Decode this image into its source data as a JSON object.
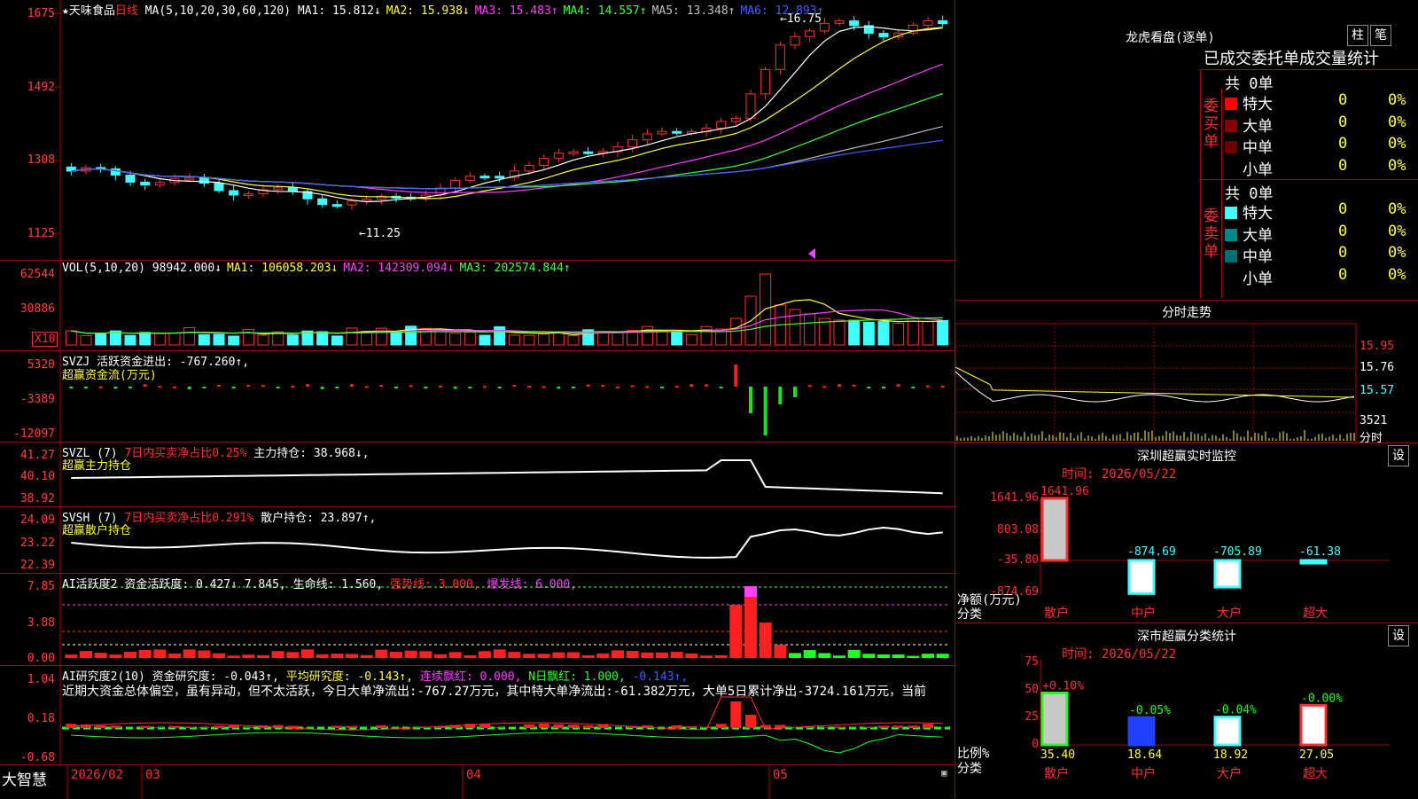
{
  "main": {
    "stock_name": "★天味食品",
    "period": "日线",
    "ma_params": "MA(5,10,20,30,60,120)",
    "ma_values": [
      {
        "label": "MA1: 15.812↓",
        "color": "#ffffff"
      },
      {
        "label": "MA2: 15.938↓",
        "color": "#ffff40"
      },
      {
        "label": "MA3: 15.483↑",
        "color": "#ff40ff"
      },
      {
        "label": "MA4: 14.557↑",
        "color": "#40ff40"
      },
      {
        "label": "MA5: 13.348↑",
        "color": "#c0c0c0"
      },
      {
        "label": "MA6: 12.893↑",
        "color": "#4060ff"
      }
    ],
    "y_ticks": [
      "1675",
      "1492",
      "1308",
      "1125"
    ],
    "high_label": "16.75",
    "low_label": "11.25"
  },
  "vol": {
    "title": "VOL(5,10,20)",
    "vals": [
      {
        "label": "98942.000↓",
        "color": "#ffffff"
      },
      {
        "label": "MA1: 106058.203↓",
        "color": "#ffff40"
      },
      {
        "label": "MA2: 142309.094↓",
        "color": "#ff40ff"
      },
      {
        "label": "MA3: 202574.844↑",
        "color": "#40ff40"
      }
    ],
    "y_ticks": [
      "62544",
      "30886"
    ],
    "unit": "X10"
  },
  "svzj": {
    "title": "SVZJ",
    "line1": "活跃资金进出: -767.260↑,",
    "line2": "超赢资金流(万元)",
    "y_ticks": [
      "5320",
      "-3389",
      "-12097"
    ]
  },
  "svzl": {
    "title": "SVZL (7)",
    "t1": "7日内买卖净占比0.25%",
    "t2": "主力持仓: 38.968↓,",
    "line2": "超赢主力持仓",
    "y_ticks": [
      "41.27",
      "40.10",
      "38.92"
    ]
  },
  "svsh": {
    "title": "SVSH (7)",
    "t1": "7日内买卖净占比0.291%",
    "t2": "散户持仓: 23.897↑,",
    "line2": "超赢散户持仓",
    "y_ticks": [
      "24.09",
      "23.22",
      "22.39"
    ]
  },
  "ai1": {
    "title": "AI活跃度2",
    "t1": "资金活跃度: 0.427↓",
    "t2": "7.845,",
    "t3": "生命线: 1.560,",
    "t4": "强势线: 3.000,",
    "t5": "爆发线: 6.000,",
    "y_ticks": [
      "7.85",
      "3.88",
      "0.00"
    ]
  },
  "ai2": {
    "title": "AI研究度2(10)",
    "t1": "资金研究度: -0.043↑,",
    "t2": "平均研究度: -0.143↑,",
    "t3": "连续飘红: 0.000,",
    "t4": "N日飘红: 1.000,",
    "t5": "-0.143↑,",
    "comment": "近期大资金总体偏空，虽有异动，但不太活跃，今日大单净流出:-767.27万元，其中特大单净流出:-61.382万元，大单5日累计净出-3724.161万元，当前",
    "y_ticks": [
      "1.04",
      "0.18",
      "-0.68"
    ]
  },
  "footer": {
    "brand": "大智慧",
    "dates": [
      "2026/02",
      "03",
      "04",
      "05"
    ]
  },
  "longhu": {
    "title": "龙虎看盘(逐单)",
    "btn_bar": "柱",
    "btn_pen": "笔",
    "tabs": "已成交委托单成交量统计",
    "buy_total": "共 0单",
    "buy_label": "委买单",
    "sell_total": "共 0单",
    "sell_label": "委卖单",
    "buy_rows": [
      {
        "name": "特大",
        "val": "0",
        "pct": "0%",
        "color": "#ff0000"
      },
      {
        "name": "大单",
        "val": "0",
        "pct": "0%",
        "color": "#8a0000"
      },
      {
        "name": "中单",
        "val": "0",
        "pct": "0%",
        "color": "#6a0000"
      },
      {
        "name": "小单",
        "val": "0",
        "pct": "0%",
        "color": "#000000"
      }
    ],
    "sell_rows": [
      {
        "name": "特大",
        "val": "0",
        "pct": "0%",
        "color": "#40ffff"
      },
      {
        "name": "大单",
        "val": "0",
        "pct": "0%",
        "color": "#008888"
      },
      {
        "name": "中单",
        "val": "0",
        "pct": "0%",
        "color": "#007070"
      },
      {
        "name": "小单",
        "val": "0",
        "pct": "0%",
        "color": "#000000"
      }
    ]
  },
  "intraday": {
    "title": "分时走势",
    "y_ticks": [
      "15.95",
      "15.76",
      "15.57"
    ],
    "vol_label": "3521",
    "unit": "分时"
  },
  "sz_monitor": {
    "title": "深圳超赢实时监控",
    "btn": "设",
    "time": "时间: 2026/05/22",
    "y_ticks": [
      "1641.96",
      "803.08",
      "-35.80",
      "-874.69"
    ],
    "bars": [
      {
        "cat": "散户",
        "value": 1641.96,
        "label": "1641.96"
      },
      {
        "cat": "中户",
        "value": -874.69,
        "label": "-874.69"
      },
      {
        "cat": "大户",
        "value": -705.89,
        "label": "-705.89"
      },
      {
        "cat": "超大",
        "value": -61.38,
        "label": "-61.38"
      }
    ],
    "ylabel": "净额(万元)",
    "xlabel": "分类"
  },
  "sh_stats": {
    "title": "深市超赢分类统计",
    "btn": "设",
    "time": "时间: 2026/05/22",
    "y_ticks": [
      "75",
      "50",
      "25",
      "0"
    ],
    "bars": [
      {
        "cat": "散户",
        "value": 35.4,
        "label": "35.40",
        "delta": "+0.10%"
      },
      {
        "cat": "中户",
        "value": 18.64,
        "label": "18.64",
        "delta": "-0.05%"
      },
      {
        "cat": "大户",
        "value": 18.92,
        "label": "18.92",
        "delta": "-0.04%"
      },
      {
        "cat": "超大",
        "value": 27.05,
        "label": "27.05",
        "delta": "-0.00%"
      }
    ],
    "ylabel": "比例%",
    "xlabel": "分类"
  }
}
